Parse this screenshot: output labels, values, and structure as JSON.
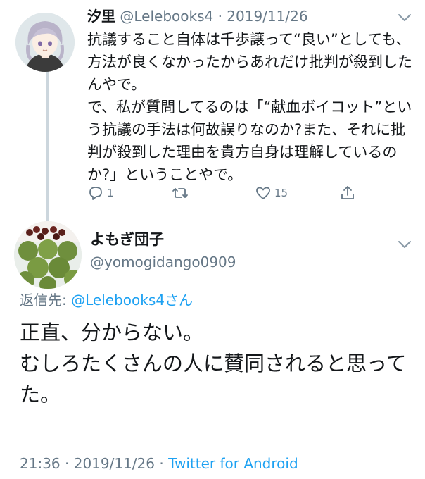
{
  "tweet1": {
    "name": "汐里",
    "handle": "@Lelebooks4",
    "separator": "·",
    "date": "2019/11/26",
    "lines": [
      "抗議すること自体は千歩譲って“良い”としても、方法が良くなかったからあれだけ批判が殺到したんやで。",
      "で、私が質問してるのは「“献血ボイコット”という抗議の手法は何故誤りなのか?また、それに批判が殺到した理由を貴方自身は理解しているのか?」ということやで。"
    ],
    "actions": {
      "reply": {
        "icon": "reply-icon",
        "count": "1"
      },
      "retweet": {
        "icon": "retweet-icon",
        "count": ""
      },
      "like": {
        "icon": "heart-icon",
        "count": "15"
      },
      "share": {
        "icon": "share-icon",
        "count": ""
      }
    }
  },
  "tweet2": {
    "name": "よもぎ団子",
    "handle": "@yomogidango0909",
    "reply_prefix": "返信先: ",
    "reply_handle": "@Lelebooks4",
    "reply_suffix": "さん",
    "lines": [
      "正直、分からない。",
      "むしろたくさんの人に賛同されると思ってた。"
    ],
    "time": "21:36",
    "separator1": "·",
    "date": "2019/11/26",
    "separator2": "·",
    "source": "Twitter for Android"
  },
  "colors": {
    "accent": "#1da1f2",
    "secondary_text": "#657786",
    "primary_text": "#14171a",
    "thread_line": "#ccd6dd"
  }
}
